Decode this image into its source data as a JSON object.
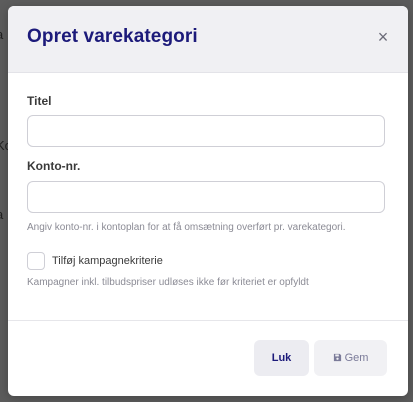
{
  "dialog": {
    "title": "Opret varekategori",
    "close_symbol": "×",
    "fields": {
      "title": {
        "label": "Titel",
        "value": "",
        "placeholder": ""
      },
      "account": {
        "label": "Konto-nr.",
        "value": "",
        "placeholder": "",
        "help": "Angiv konto-nr. i kontoplan for at få omsætning overført pr. varekategori."
      }
    },
    "campaign": {
      "label": "Tilføj kampagnekriterie",
      "checked": false,
      "help": "Kampagner inkl. tilbudspriser udløses ikke før kriteriet er opfyldt"
    },
    "buttons": {
      "close_label": "Luk",
      "save_label": "Gem"
    }
  },
  "backdrop_fragments": [
    "a",
    "Ko",
    "a"
  ],
  "icons": {
    "close": "close-icon",
    "save": "floppy-disk-icon"
  },
  "colors": {
    "title": "#1c1a7a",
    "header_bg": "#f0f0f3",
    "overlay": "#5c5c5c",
    "help_text": "#8b8b95",
    "save_text": "#7b7b99"
  }
}
